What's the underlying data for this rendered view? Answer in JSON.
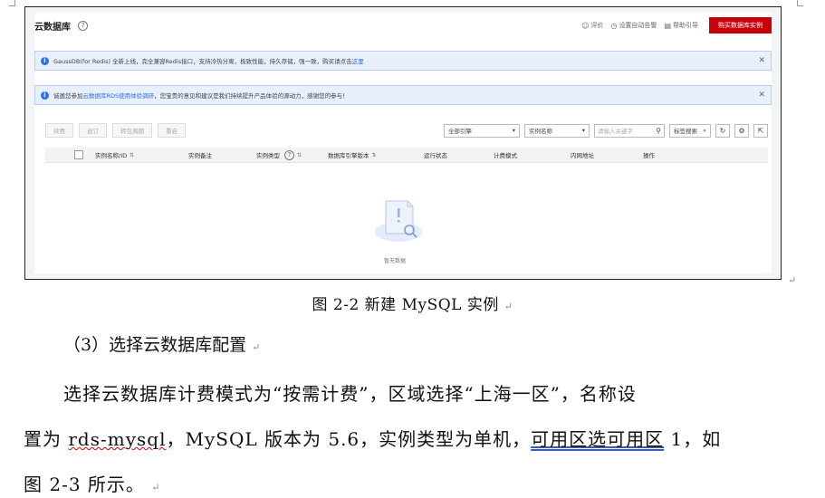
{
  "screenshot": {
    "title": "云数据库",
    "top_links": {
      "feedback": "评价",
      "alarm": "设置自动告警",
      "help": "帮助引导"
    },
    "buy_button": "购买数据库实例",
    "notice1": {
      "before": "GaussDB(for Redis) 全新上线，完全兼容Redis接口，支持冷热分离，极致性能，持久存储，强一致，购买请点击",
      "link": "这里"
    },
    "notice2": {
      "before": "诚邀您参加",
      "link": "云数据库RDS使用体验调研",
      "after": "，您宝贵的意见和建议是我们持续提升产品体验的源动力，感谢您的参与！"
    },
    "toolbar": {
      "buttons": [
        "续费",
        "退订",
        "转包周期",
        "重启"
      ],
      "engine_select": "全部引擎",
      "name_select": "实例名称",
      "search_placeholder": "请输入关键字",
      "tag_search": "标签搜索"
    },
    "columns": [
      "实例名称/ID",
      "实例备注",
      "实例类型",
      "数据库引擎版本",
      "运行状态",
      "计费模式",
      "内网地址",
      "操作"
    ],
    "empty_text": "暂无数据"
  },
  "document": {
    "caption": "图  2-2 新建  MySQL 实例",
    "subheading": "（3）选择云数据库配置",
    "line1": "选择云数据库计费模式为“按需计费”，区域选择“上海一区”，名称设",
    "line2_a": "置为 ",
    "line2_squiggle": "rds-mysql",
    "line2_b": "，MySQL 版本为 5.6，实例类型为单机，",
    "line2_underlined": "可用区选可用区",
    "line2_c": " 1，如",
    "line3": "图  2-3 所示。",
    "para_mark": "↵"
  }
}
